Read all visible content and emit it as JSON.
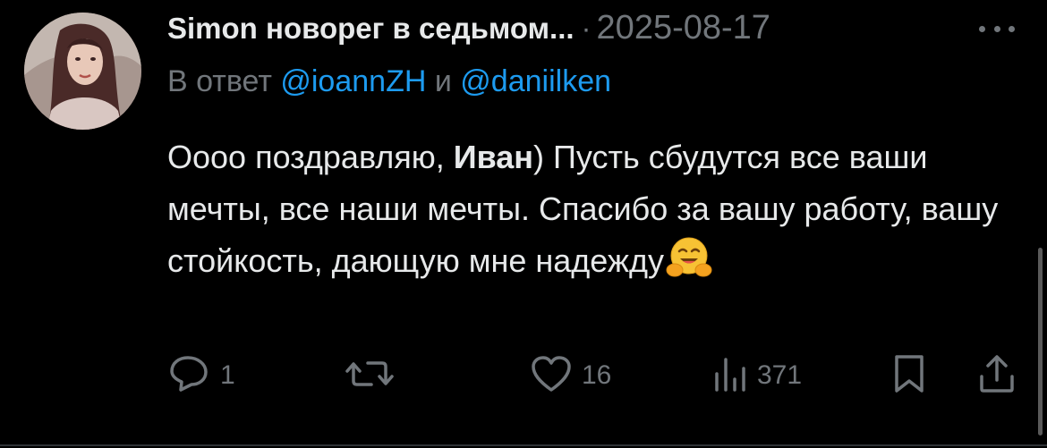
{
  "tweet": {
    "author_name": "Simon новорег в седьмом...",
    "separator": "·",
    "date": "2025-08-17",
    "reply_prefix": "В ответ",
    "mention_1": "@ioannZH",
    "reply_and": "и",
    "mention_2": "@daniilken",
    "text_part1": "Оооо поздравляю, ",
    "text_bold": "Иван",
    "text_part2": ") Пусть сбудутся все ваши мечты, все наши мечты. Спасибо за вашу работу, вашу стойкость, дающую мне надежду",
    "emoji": "hugging-face-emoji"
  },
  "actions": {
    "reply_count": "1",
    "retweet_count": "",
    "like_count": "16",
    "views_count": "371"
  },
  "icons": [
    "more-options-icon",
    "reply-icon",
    "retweet-icon",
    "like-icon",
    "views-icon",
    "bookmark-icon",
    "share-icon"
  ],
  "colors": {
    "background": "#000000",
    "text": "#e7e9ea",
    "muted": "#71767b",
    "link": "#1d9bf0"
  }
}
